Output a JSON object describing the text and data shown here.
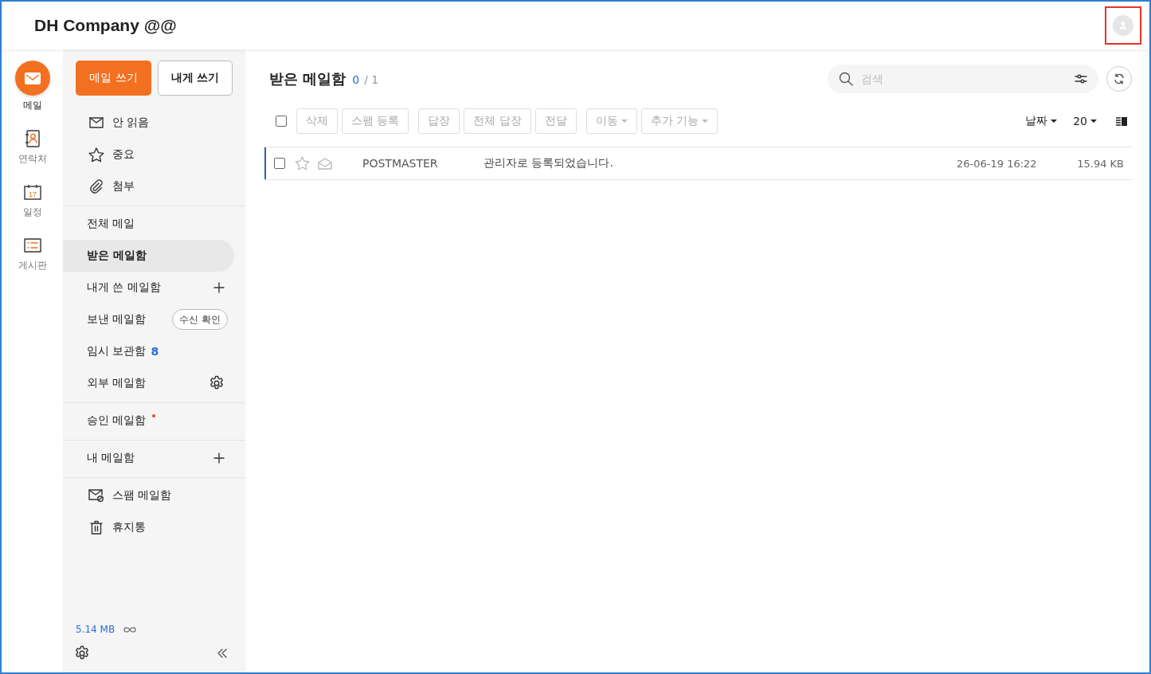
{
  "header": {
    "title": "DH Company @@"
  },
  "rail": [
    {
      "label": "메일",
      "kind": "mail",
      "selected": true
    },
    {
      "label": "연락처",
      "kind": "contacts",
      "selected": false
    },
    {
      "label": "일정",
      "kind": "calendar",
      "day": "17",
      "selected": false
    },
    {
      "label": "게시판",
      "kind": "board",
      "selected": false
    }
  ],
  "compose_buttons": [
    {
      "label": "메일 쓰기",
      "kind": "primary"
    },
    {
      "label": "내게 쓰기",
      "kind": "secondary"
    }
  ],
  "folder_groups": [
    [
      {
        "label": "안 읽음",
        "kind": "unread",
        "selected": false
      },
      {
        "label": "중요",
        "kind": "starred",
        "selected": false
      },
      {
        "label": "첨부",
        "kind": "attachments",
        "selected": false
      }
    ],
    [
      {
        "label": "전체 메일",
        "kind": "plain",
        "selected": false
      },
      {
        "label": "받은 메일함",
        "kind": "plain",
        "selected": true
      },
      {
        "label": "내게 쓴 메일함",
        "kind": "addable",
        "selected": false
      },
      {
        "label": "보낸 메일함",
        "kind": "receipt",
        "selected": false,
        "action_label": "수신 확인"
      },
      {
        "label": "임시 보관함",
        "kind": "plain",
        "selected": false,
        "count": "8"
      },
      {
        "label": "외부 메일함",
        "kind": "configurable",
        "selected": false
      }
    ],
    [
      {
        "label": "승인 메일함",
        "kind": "plain",
        "selected": false,
        "color": "#e8441f"
      }
    ],
    [
      {
        "label": "내 메일함",
        "kind": "addable",
        "selected": false
      }
    ],
    [
      {
        "label": "스팸 메일함",
        "kind": "spam",
        "selected": false
      },
      {
        "label": "휴지통",
        "kind": "trash",
        "selected": false
      }
    ]
  ],
  "storage": {
    "used": "5.14 MB"
  },
  "mailbox": {
    "title": "받은 메일함",
    "selected_count": "0",
    "total": "/ 1"
  },
  "search": {
    "placeholder": "검색"
  },
  "toolbar": {
    "select_all_checked": false,
    "groups": [
      [
        {
          "label": "삭제",
          "kind": "plain",
          "disabled": true
        },
        {
          "label": "스팸 등록",
          "kind": "plain",
          "disabled": true
        }
      ],
      [
        {
          "label": "답장",
          "kind": "plain",
          "disabled": true
        },
        {
          "label": "전체 답장",
          "kind": "plain",
          "disabled": true
        },
        {
          "label": "전달",
          "kind": "plain",
          "disabled": true
        }
      ],
      [
        {
          "label": "이동",
          "kind": "dropdown",
          "disabled": true
        },
        {
          "label": "추가 기능",
          "kind": "dropdown",
          "disabled": true
        }
      ]
    ],
    "sort": "날짜",
    "page_size": "20"
  },
  "messages": [
    {
      "sender": "POSTMASTER",
      "subject": "관리자로 등록되었습니다.",
      "date": "26-06-19 16:22",
      "size": "15.94 KB",
      "checked": false,
      "starred": false,
      "read": true,
      "focused": true
    }
  ]
}
